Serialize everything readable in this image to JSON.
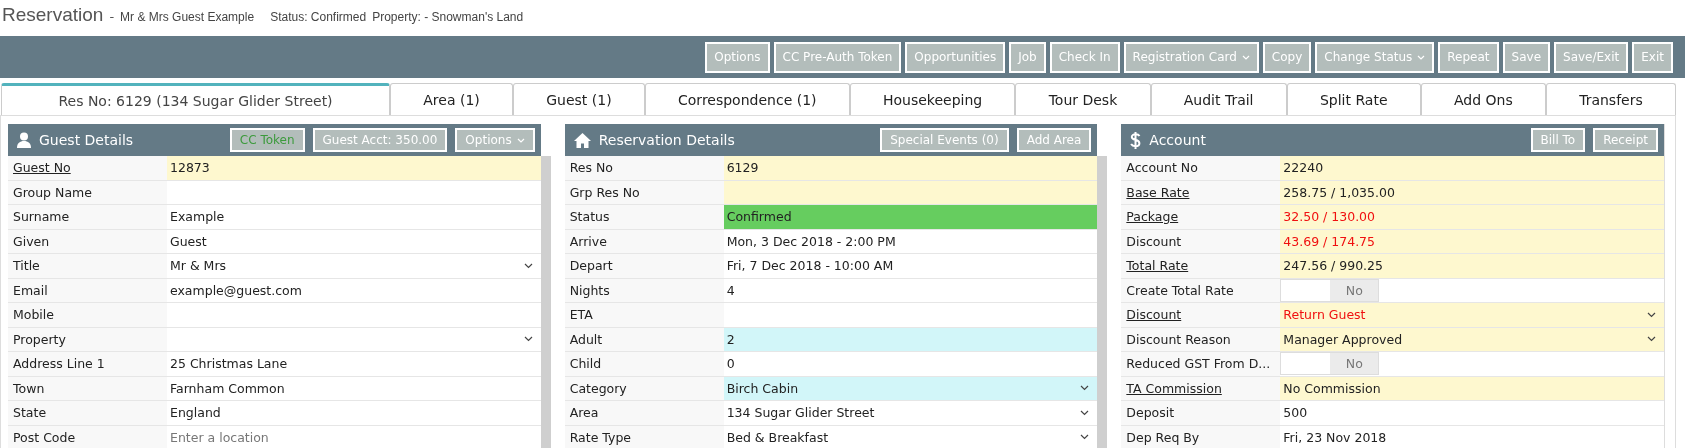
{
  "header": {
    "title": "Reservation",
    "separator": "-",
    "guest": "Mr & Mrs Guest Example",
    "status": "Status: Confirmed",
    "property": "Property: - Snowman's Land"
  },
  "toolbar": [
    {
      "label": "Options",
      "dropdown": false
    },
    {
      "label": "CC Pre-Auth Token",
      "dropdown": false
    },
    {
      "label": "Opportunities",
      "dropdown": false
    },
    {
      "label": "Job",
      "dropdown": false
    },
    {
      "label": "Check In",
      "dropdown": false
    },
    {
      "label": "Registration Card",
      "dropdown": true
    },
    {
      "label": "Copy",
      "dropdown": false
    },
    {
      "label": "Change Status",
      "dropdown": true
    },
    {
      "label": "Repeat",
      "dropdown": false
    },
    {
      "label": "Save",
      "dropdown": false
    },
    {
      "label": "Save/Exit",
      "dropdown": false
    },
    {
      "label": "Exit",
      "dropdown": false
    }
  ],
  "tabs": [
    {
      "label": "Res No: 6129 (134 Sugar Glider Street)",
      "selected": true
    },
    {
      "label": "Area (1)",
      "selected": false
    },
    {
      "label": "Guest (1)",
      "selected": false
    },
    {
      "label": "Correspondence (1)",
      "selected": false
    },
    {
      "label": "Housekeeping",
      "selected": false
    },
    {
      "label": "Tour Desk",
      "selected": false
    },
    {
      "label": "Audit Trail",
      "selected": false
    },
    {
      "label": "Split Rate",
      "selected": false
    },
    {
      "label": "Add Ons",
      "selected": false
    },
    {
      "label": "Transfers",
      "selected": false
    }
  ],
  "panels": [
    {
      "title": "Guest Details",
      "scrollbar": true,
      "buttons": [
        {
          "label": "CC Token",
          "kind": "token"
        },
        {
          "label": "Guest Acct: 350.00",
          "kind": "plain"
        },
        {
          "label": "Options",
          "kind": "menu"
        }
      ],
      "rows": [
        {
          "label": "Guest No",
          "link": true,
          "kind": "text",
          "value": "12873",
          "color": "#fef8cf"
        },
        {
          "label": "Group Name",
          "link": false,
          "kind": "text"
        },
        {
          "label": "Surname",
          "link": false,
          "kind": "text",
          "value": "Example"
        },
        {
          "label": "Given",
          "link": false,
          "kind": "text",
          "value": "Guest"
        },
        {
          "label": "Title",
          "link": false,
          "kind": "select",
          "value": "Mr & Mrs"
        },
        {
          "label": "Email",
          "link": false,
          "kind": "text",
          "value": "example@guest.com"
        },
        {
          "label": "Mobile",
          "link": false,
          "kind": "text"
        },
        {
          "label": "Property",
          "link": false,
          "kind": "select"
        },
        {
          "label": "Address Line 1",
          "link": false,
          "kind": "text",
          "value": "25 Christmas Lane"
        },
        {
          "label": "Town",
          "link": false,
          "kind": "text",
          "value": "Farnham Common"
        },
        {
          "label": "State",
          "link": false,
          "kind": "text",
          "value": "England"
        },
        {
          "label": "Post Code",
          "link": false,
          "kind": "text",
          "placeholder": "Enter a location"
        }
      ]
    },
    {
      "title": "Reservation Details",
      "scrollbar": true,
      "buttons": [
        {
          "label": "Special Events (0)",
          "kind": "plain"
        },
        {
          "label": "Add Area",
          "kind": "plain"
        }
      ],
      "rows": [
        {
          "label": "Res No",
          "link": false,
          "kind": "text",
          "value": "6129",
          "color": "#fef8cf"
        },
        {
          "label": "Grp Res No",
          "link": false,
          "kind": "text",
          "color": "#fef8cf"
        },
        {
          "label": "Status",
          "link": false,
          "kind": "text",
          "value": "Confirmed",
          "color": "#66cd5f"
        },
        {
          "label": "Arrive",
          "link": false,
          "kind": "text",
          "value": "Mon, 3 Dec 2018 - 2:00 PM"
        },
        {
          "label": "Depart",
          "link": false,
          "kind": "text",
          "value": "Fri, 7 Dec 2018 - 10:00 AM"
        },
        {
          "label": "Nights",
          "link": false,
          "kind": "text",
          "value": "4"
        },
        {
          "label": "ETA",
          "link": false,
          "kind": "text"
        },
        {
          "label": "Adult",
          "link": false,
          "kind": "text",
          "value": "2",
          "color": "#d2f6f9"
        },
        {
          "label": "Child",
          "link": false,
          "kind": "text",
          "value": "0"
        },
        {
          "label": "Category",
          "link": false,
          "kind": "select",
          "value": "Birch Cabin",
          "color": "#d2f6f9"
        },
        {
          "label": "Area",
          "link": false,
          "kind": "select",
          "value": "134 Sugar Glider Street"
        },
        {
          "label": "Rate Type",
          "link": false,
          "kind": "select",
          "value": "Bed & Breakfast"
        }
      ]
    },
    {
      "title": "Account",
      "scrollbar": false,
      "buttons": [
        {
          "label": "Bill To",
          "kind": "plain"
        },
        {
          "label": "Receipt",
          "kind": "plain"
        }
      ],
      "rows": [
        {
          "label": "Account No",
          "link": false,
          "kind": "text",
          "value": "22240",
          "color": "#fef8cf"
        },
        {
          "label": "Base Rate",
          "link": true,
          "kind": "text",
          "value": "258.75 / 1,035.00",
          "color": "#fef8cf"
        },
        {
          "label": "Package",
          "link": true,
          "kind": "text",
          "value": "32.50 / 130.00",
          "color": "#fef8cf",
          "negative": true
        },
        {
          "label": "Discount",
          "link": false,
          "kind": "text",
          "value": "43.69 / 174.75",
          "color": "#fef8cf",
          "negative": true
        },
        {
          "label": "Total Rate",
          "link": true,
          "kind": "text",
          "value": "247.56 / 990.25",
          "color": "#fef8cf"
        },
        {
          "label": "Create Total Rate",
          "link": false,
          "kind": "toggle",
          "value": "No",
          "on": false
        },
        {
          "label": "Discount",
          "link": true,
          "kind": "select",
          "value": "Return Guest",
          "color": "#fef8cf",
          "negative": true
        },
        {
          "label": "Discount Reason",
          "link": false,
          "kind": "select",
          "value": "Manager Approved",
          "color": "#fef8cf"
        },
        {
          "label": "Reduced GST From D...",
          "link": false,
          "kind": "toggle",
          "value": "No",
          "on": false
        },
        {
          "label": "TA Commission",
          "link": true,
          "kind": "text",
          "value": "No Commission",
          "color": "#fef8cf"
        },
        {
          "label": "Deposit",
          "link": false,
          "kind": "text",
          "value": "500"
        },
        {
          "label": "Dep Req By",
          "link": false,
          "kind": "text",
          "value": "Fri, 23 Nov 2018"
        }
      ]
    }
  ]
}
